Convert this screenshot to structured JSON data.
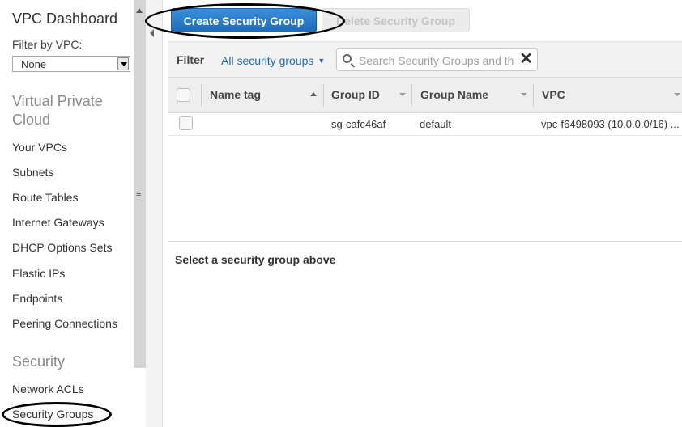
{
  "sidebar": {
    "title": "VPC Dashboard",
    "filter_label": "Filter by VPC:",
    "filter_value": "None",
    "section_vpc": "Virtual Private Cloud",
    "vpc_items": [
      "Your VPCs",
      "Subnets",
      "Route Tables",
      "Internet Gateways",
      "DHCP Options Sets",
      "Elastic IPs",
      "Endpoints",
      "Peering Connections"
    ],
    "section_security": "Security",
    "security_items": [
      "Network ACLs",
      "Security Groups"
    ]
  },
  "toolbar": {
    "create_label": "Create Security Group",
    "delete_label": "Delete Security Group"
  },
  "filter": {
    "label": "Filter",
    "dropdown_value": "All security groups",
    "search_placeholder": "Search Security Groups and th"
  },
  "table": {
    "columns": [
      "Name tag",
      "Group ID",
      "Group Name",
      "VPC"
    ],
    "rows": [
      {
        "name_tag": "",
        "group_id": "sg-cafc46af",
        "group_name": "default",
        "vpc": "vpc-f6498093 (10.0.0.0/16) ..."
      }
    ]
  },
  "detail": {
    "message": "Select a security group above"
  },
  "colors": {
    "accent": "#1f6cb8",
    "section_header": "#8a8a8a"
  }
}
